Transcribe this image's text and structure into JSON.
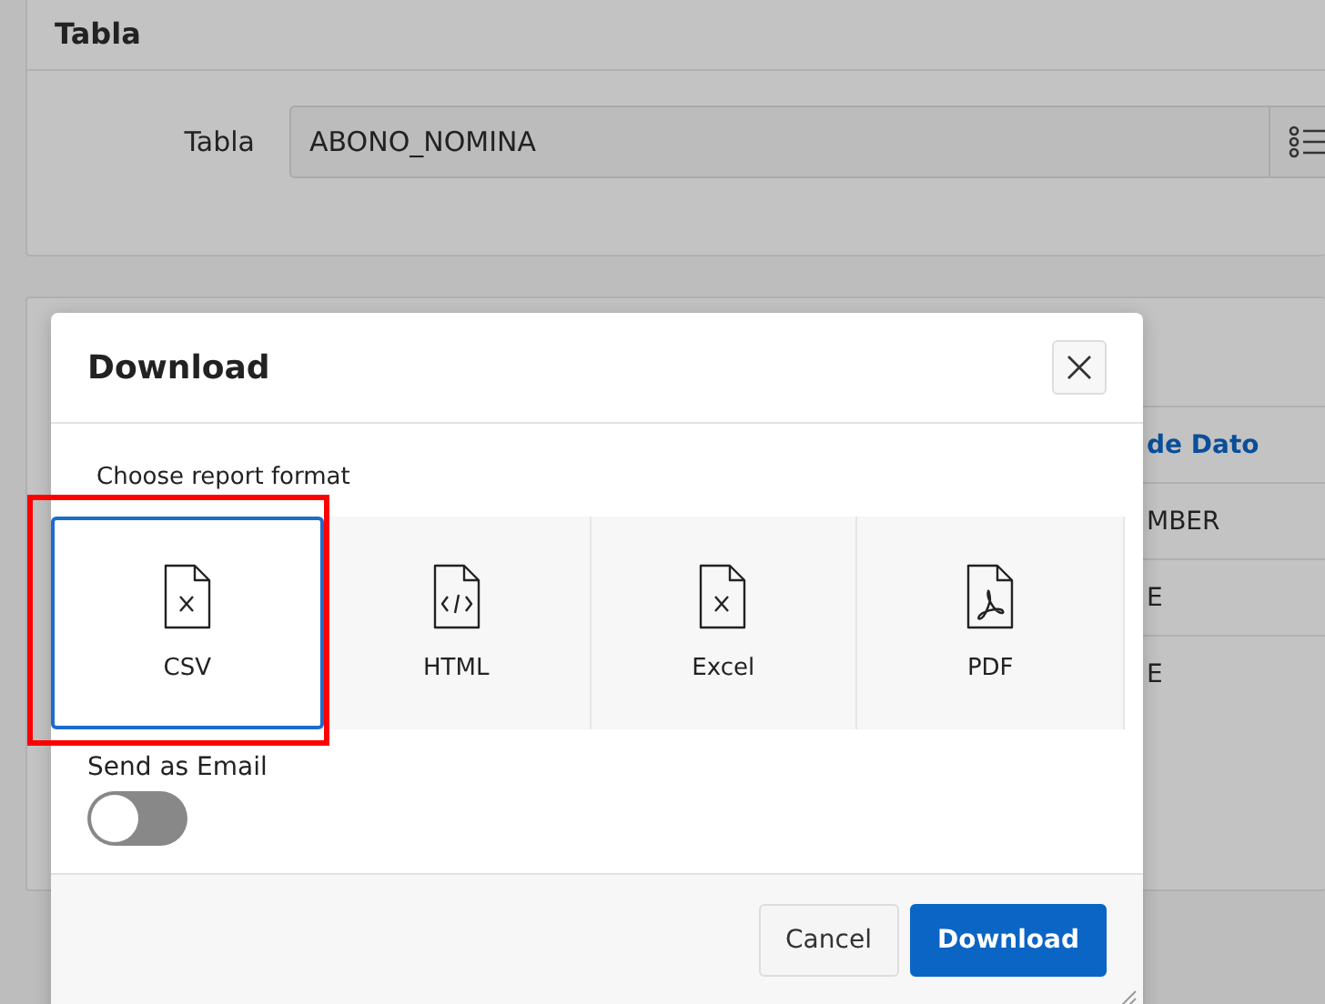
{
  "page": {
    "panel_title": "Tabla",
    "field": {
      "label": "Tabla",
      "value": "ABONO_NOMINA"
    },
    "table": {
      "column_header": "de Dato",
      "cells": [
        "MBER",
        "E",
        "E"
      ]
    }
  },
  "dialog": {
    "title": "Download",
    "format_label": "Choose report format",
    "formats": [
      {
        "label": "CSV",
        "kind": "csv",
        "selected": true
      },
      {
        "label": "HTML",
        "kind": "html",
        "selected": false
      },
      {
        "label": "Excel",
        "kind": "excel",
        "selected": false
      },
      {
        "label": "PDF",
        "kind": "pdf",
        "selected": false
      }
    ],
    "email": {
      "label": "Send as Email",
      "on": false
    },
    "buttons": [
      {
        "label": "Cancel",
        "kind": "secondary"
      },
      {
        "label": "Download",
        "kind": "primary"
      }
    ]
  }
}
